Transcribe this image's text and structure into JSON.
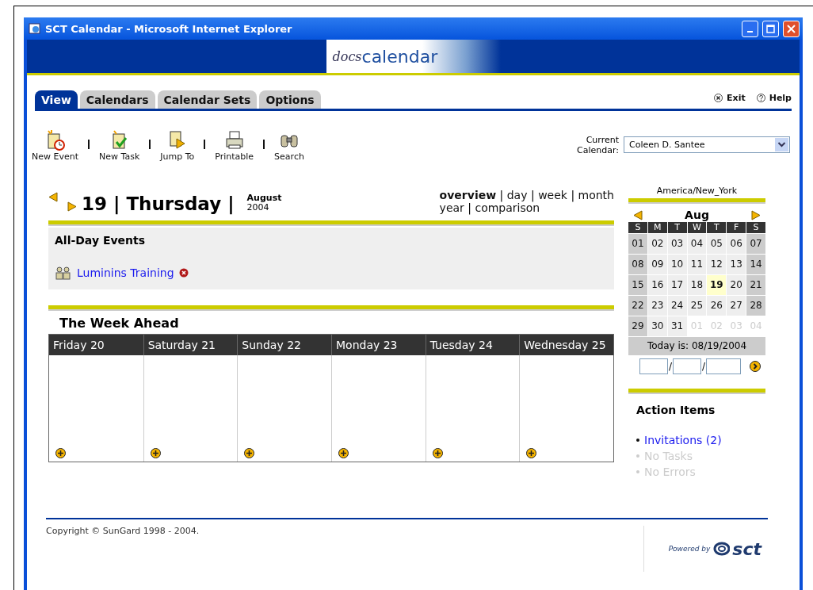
{
  "window": {
    "title": "SCT Calendar - Microsoft Internet Explorer"
  },
  "banner": {
    "logo_part_1": "docs",
    "logo_part_2": "calendar"
  },
  "tabs": [
    {
      "label": "View",
      "selected": true
    },
    {
      "label": "Calendars",
      "selected": false
    },
    {
      "label": "Calendar Sets",
      "selected": false
    },
    {
      "label": "Options",
      "selected": false
    }
  ],
  "header_links": [
    {
      "label": "Exit",
      "kind": "exit"
    },
    {
      "label": "Help",
      "kind": "help"
    }
  ],
  "toolbar": [
    {
      "label": "New Event",
      "kind": "event"
    },
    {
      "label": "New Task",
      "kind": "task"
    },
    {
      "label": "Jump To",
      "kind": "jump"
    },
    {
      "label": "Printable",
      "kind": "print"
    },
    {
      "label": "Search",
      "kind": "search"
    }
  ],
  "current_calendar": {
    "label_line_1": "Current",
    "label_line_2": "Calendar:",
    "value": "Coleen D. Santee"
  },
  "day_header": {
    "title": "19 | Thursday |",
    "month": "August",
    "year": "2004"
  },
  "view_lines": [
    {
      "links": [
        {
          "label": "overview",
          "selected": true,
          "separator": "|"
        },
        {
          "label": "day",
          "selected": false,
          "separator": "|"
        },
        {
          "label": "week",
          "selected": false,
          "separator": "|"
        },
        {
          "label": "month",
          "selected": false
        }
      ]
    },
    {
      "links": [
        {
          "label": "year",
          "selected": false,
          "separator": "|"
        },
        {
          "label": "comparison",
          "selected": false
        }
      ]
    }
  ],
  "all_day_events": {
    "heading": "All-Day Events",
    "events": [
      {
        "title": "Luminins Training"
      }
    ]
  },
  "week_ahead": {
    "title": "The Week Ahead",
    "days": [
      "Friday 20",
      "Saturday 21",
      "Sunday 22",
      "Monday 23",
      "Tuesday 24",
      "Wednesday 25"
    ]
  },
  "mini_calendar": {
    "timezone": "America/New_York",
    "month": "Aug",
    "weekdays": [
      "S",
      "M",
      "T",
      "W",
      "T",
      "F",
      "S"
    ],
    "weeks": [
      {
        "days": [
          {
            "label": "01",
            "kind": "weekend",
            "selected": false
          },
          {
            "label": "02",
            "kind": "weekday",
            "selected": false
          },
          {
            "label": "03",
            "kind": "weekday",
            "selected": false
          },
          {
            "label": "04",
            "kind": "weekday",
            "selected": false
          },
          {
            "label": "05",
            "kind": "weekday",
            "selected": false
          },
          {
            "label": "06",
            "kind": "weekday",
            "selected": false
          },
          {
            "label": "07",
            "kind": "weekend",
            "selected": false
          }
        ]
      },
      {
        "days": [
          {
            "label": "08",
            "kind": "weekend",
            "selected": false
          },
          {
            "label": "09",
            "kind": "weekday",
            "selected": false
          },
          {
            "label": "10",
            "kind": "weekday",
            "selected": false
          },
          {
            "label": "11",
            "kind": "weekday",
            "selected": false
          },
          {
            "label": "12",
            "kind": "weekday",
            "selected": false
          },
          {
            "label": "13",
            "kind": "weekday",
            "selected": false
          },
          {
            "label": "14",
            "kind": "weekend",
            "selected": false
          }
        ]
      },
      {
        "days": [
          {
            "label": "15",
            "kind": "weekend",
            "selected": false
          },
          {
            "label": "16",
            "kind": "weekday",
            "selected": false
          },
          {
            "label": "17",
            "kind": "weekday",
            "selected": false
          },
          {
            "label": "18",
            "kind": "weekday",
            "selected": false
          },
          {
            "label": "19",
            "kind": "weekday",
            "selected": true
          },
          {
            "label": "20",
            "kind": "weekday",
            "selected": false
          },
          {
            "label": "21",
            "kind": "weekend",
            "selected": false
          }
        ]
      },
      {
        "days": [
          {
            "label": "22",
            "kind": "weekend",
            "selected": false
          },
          {
            "label": "23",
            "kind": "weekday",
            "selected": false
          },
          {
            "label": "24",
            "kind": "weekday",
            "selected": false
          },
          {
            "label": "25",
            "kind": "weekday",
            "selected": false
          },
          {
            "label": "26",
            "kind": "weekday",
            "selected": false
          },
          {
            "label": "27",
            "kind": "weekday",
            "selected": false
          },
          {
            "label": "28",
            "kind": "weekend",
            "selected": false
          }
        ]
      },
      {
        "days": [
          {
            "label": "29",
            "kind": "weekend",
            "selected": false
          },
          {
            "label": "30",
            "kind": "weekday",
            "selected": false
          },
          {
            "label": "31",
            "kind": "weekday",
            "selected": false
          },
          {
            "label": "01",
            "kind": "outside",
            "selected": false
          },
          {
            "label": "02",
            "kind": "outside",
            "selected": false
          },
          {
            "label": "03",
            "kind": "outside",
            "selected": false
          },
          {
            "label": "04",
            "kind": "outside",
            "selected": false
          }
        ]
      }
    ],
    "today": "Today is: 08/19/2004",
    "date_separators": [
      "/",
      "/"
    ]
  },
  "action_items": {
    "title": "Action Items",
    "items": [
      {
        "label": "Invitations (2)",
        "disabled": false
      },
      {
        "label": "No Tasks",
        "disabled": true
      },
      {
        "label": "No Errors",
        "disabled": true
      }
    ]
  },
  "footer": {
    "copyright": "Copyright © SunGard 1998 - 2004.",
    "powered_by": "Powered by",
    "logo": "sct"
  }
}
